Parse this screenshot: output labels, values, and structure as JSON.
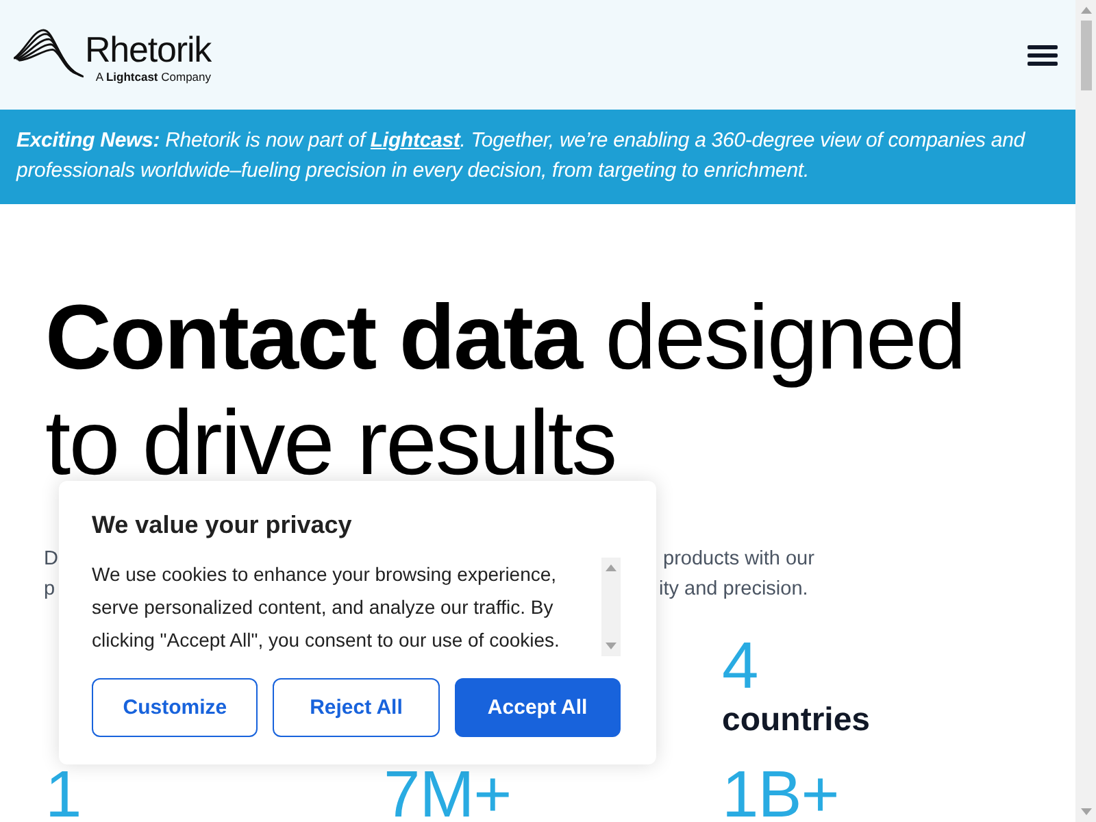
{
  "header": {
    "logo": {
      "wordmark": "Rhetorik",
      "tagline": "A **Lightcast** Company"
    }
  },
  "banner": {
    "lead": "**Exciting News:** Rhetorik is now part of ",
    "link": "Lightcast",
    "rest": ". Together, we’re enabling a 360-degree view of companies and professionals worldwide–fueling precision in every decision, from targeting to enrichment."
  },
  "hero": {
    "headline": "**Contact data** designed to drive results",
    "intro_lines": [
      {
        "left": "D",
        "right": "products with our"
      },
      {
        "left": "p",
        "right": "ity and precision."
      }
    ]
  },
  "stats": [
    [
      {
        "value": "4",
        "label": "countries"
      }
    ],
    [
      {
        "value": "1"
      },
      {
        "value": "7M+"
      },
      {
        "value": "1B+"
      }
    ]
  ],
  "cookie_dialog": {
    "title": "We value your privacy",
    "text": "We use cookies to enhance your browsing experience, serve personalized content, and analyze our traffic. By clicking \"Accept All\", you consent to our use of cookies.",
    "buttons": [
      {
        "label": "Customize",
        "kind": "outline"
      },
      {
        "label": "Reject All",
        "kind": "outline"
      },
      {
        "label": "Accept All",
        "kind": "primary"
      }
    ]
  }
}
